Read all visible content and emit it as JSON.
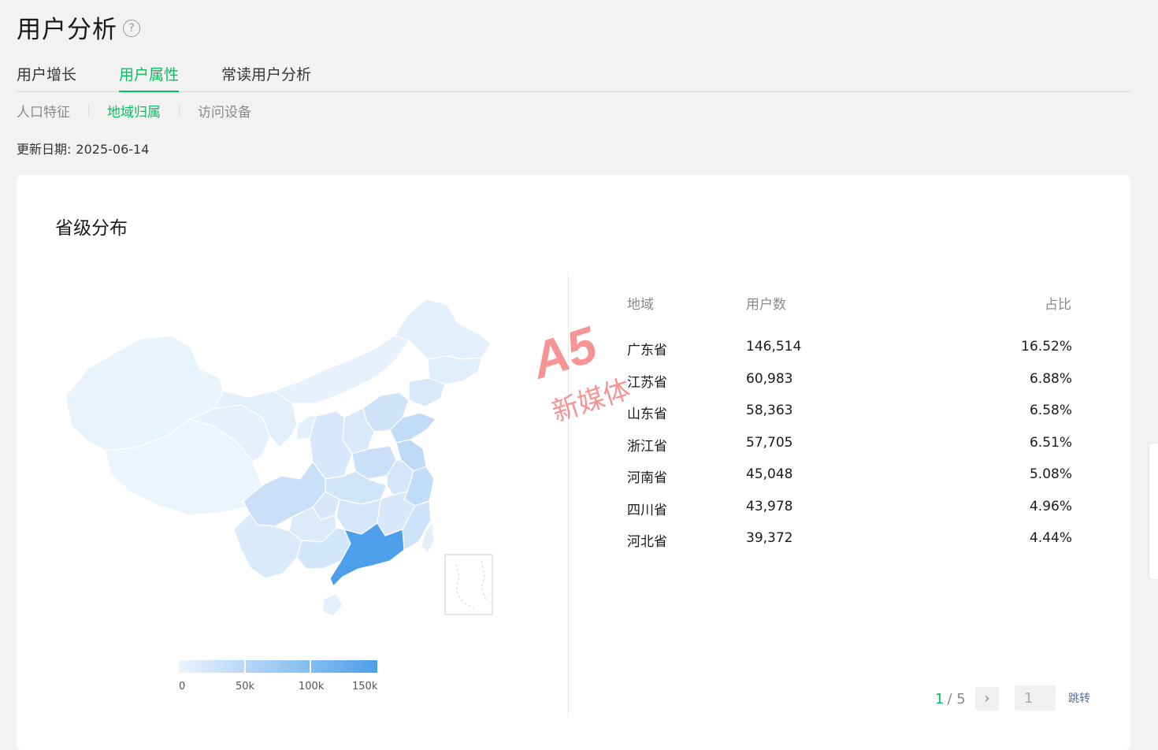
{
  "header": {
    "title": "用户分析",
    "help_icon": "question-circle-icon"
  },
  "main_tabs": [
    {
      "label": "用户增长",
      "active": false
    },
    {
      "label": "用户属性",
      "active": true
    },
    {
      "label": "常读用户分析",
      "active": false
    }
  ],
  "sub_tabs": [
    {
      "label": "人口特征",
      "active": false
    },
    {
      "label": "地域归属",
      "active": true
    },
    {
      "label": "访问设备",
      "active": false
    }
  ],
  "update": {
    "label": "更新日期:",
    "date": "2025-06-14"
  },
  "card": {
    "title": "省级分布"
  },
  "map": {
    "legend_labels": [
      "0",
      "50k",
      "100k",
      "150k"
    ],
    "color_low": "#eaf4fd",
    "color_high": "#4e9fe9"
  },
  "table": {
    "headers": {
      "region": "地域",
      "users": "用户数",
      "share": "占比"
    },
    "rows": [
      {
        "region": "广东省",
        "users": "146,514",
        "share": "16.52%"
      },
      {
        "region": "江苏省",
        "users": "60,983",
        "share": "6.88%"
      },
      {
        "region": "山东省",
        "users": "58,363",
        "share": "6.58%"
      },
      {
        "region": "浙江省",
        "users": "57,705",
        "share": "6.51%"
      },
      {
        "region": "河南省",
        "users": "45,048",
        "share": "5.08%"
      },
      {
        "region": "四川省",
        "users": "43,978",
        "share": "4.96%"
      },
      {
        "region": "河北省",
        "users": "39,372",
        "share": "4.44%"
      }
    ]
  },
  "pager": {
    "current": "1",
    "total": "/ 5",
    "input_value": "1",
    "jump_label": "跳转",
    "next_icon": "chevron-right-icon"
  },
  "watermark": {
    "logo": "A5",
    "text": "新媒体"
  },
  "colors": {
    "accent": "#07c160",
    "link": "#576b95"
  }
}
